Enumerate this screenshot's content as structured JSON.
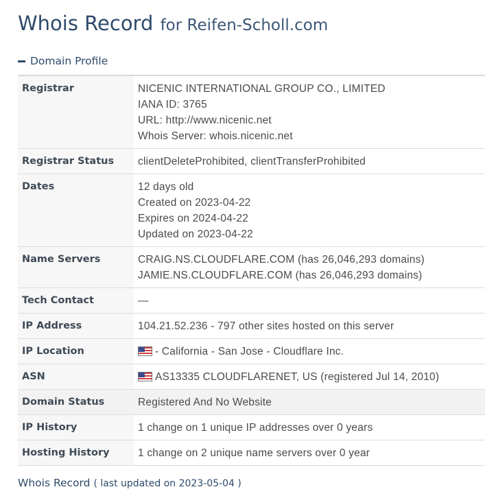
{
  "title": {
    "main": "Whois Record",
    "sub": "for Reifen-Scholl.com"
  },
  "section": {
    "toggle_icon": "minus-icon",
    "label": "Domain Profile"
  },
  "rows": [
    {
      "label": "Registrar",
      "lines": [
        "NICENIC INTERNATIONAL GROUP CO., LIMITED",
        "IANA ID: 3765",
        "URL: http://www.nicenic.net",
        "Whois Server: whois.nicenic.net"
      ]
    },
    {
      "label": "Registrar Status",
      "lines": [
        "clientDeleteProhibited, clientTransferProhibited"
      ]
    },
    {
      "label": "Dates",
      "lines": [
        "12 days old",
        "Created on 2023-04-22",
        "Expires on 2024-04-22",
        "Updated on 2023-04-22"
      ]
    },
    {
      "label": "Name Servers",
      "lines": [
        "CRAIG.NS.CLOUDFLARE.COM (has 26,046,293 domains)",
        "JAMIE.NS.CLOUDFLARE.COM (has 26,046,293 domains)"
      ]
    },
    {
      "label": "Tech Contact",
      "lines": [
        "—"
      ]
    },
    {
      "label": "IP Address",
      "lines": [
        "104.21.52.236 - 797 other sites hosted on this server"
      ]
    },
    {
      "label": "IP Location",
      "flag": "us-flag-icon",
      "lines": [
        "- California - San Jose - Cloudflare Inc."
      ]
    },
    {
      "label": "ASN",
      "flag": "us-flag-icon",
      "lines": [
        "AS13335 CLOUDFLARENET, US (registered Jul 14, 2010)"
      ]
    },
    {
      "label": "Domain Status",
      "lines": [
        "Registered And No Website"
      ]
    },
    {
      "label": "IP History",
      "lines": [
        "1 change on 1 unique IP addresses over 0 years"
      ]
    },
    {
      "label": "Hosting History",
      "lines": [
        "1 change on 2 unique name servers over 0 year"
      ]
    }
  ],
  "footer": {
    "link": "Whois Record",
    "note": "( last updated on 2023-05-04 )"
  },
  "colors": {
    "heading": "#2e4a6b",
    "text": "#4a4a4a",
    "row_highlight": "#f2f2f2"
  }
}
